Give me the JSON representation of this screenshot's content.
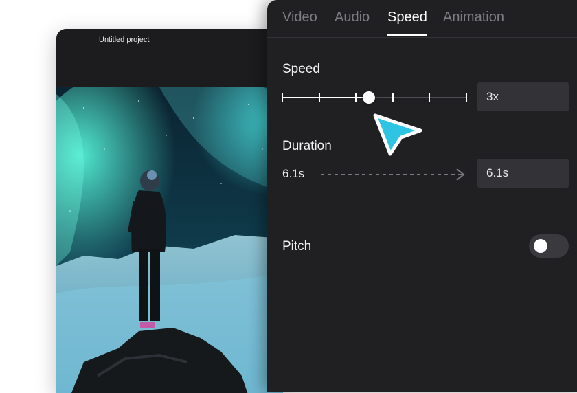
{
  "editor": {
    "project_title": "Untitled project"
  },
  "panel": {
    "tabs": [
      {
        "label": "Video",
        "active": false
      },
      {
        "label": "Audio",
        "active": false
      },
      {
        "label": "Speed",
        "active": true
      },
      {
        "label": "Animation",
        "active": false
      }
    ],
    "speed": {
      "label": "Speed",
      "value": "3x",
      "slider_position": 0.47
    },
    "duration": {
      "label": "Duration",
      "original": "6.1s",
      "new": "6.1s"
    },
    "pitch": {
      "label": "Pitch",
      "enabled": false
    }
  },
  "colors": {
    "panel_bg": "#202023",
    "accent_cursor": "#2ec4e3"
  },
  "icons": {
    "pointer": "pointer-cursor-icon",
    "arrow": "dashed-arrow-right-icon"
  }
}
